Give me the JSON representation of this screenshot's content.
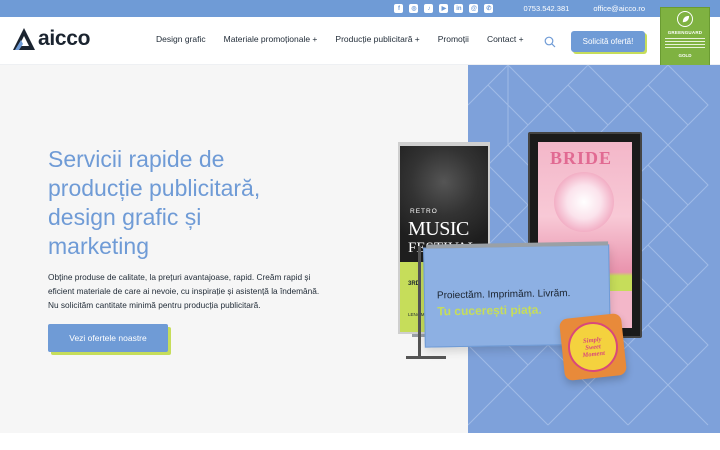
{
  "topbar": {
    "socials": [
      "facebook-icon",
      "instagram-icon",
      "tiktok-icon",
      "youtube-icon",
      "linkedin-icon",
      "threads-icon",
      "whatsapp-icon"
    ],
    "phone": "0753.542.381",
    "email": "office@aicco.ro"
  },
  "header": {
    "logo_text": "aicco",
    "nav": [
      {
        "label": "Design grafic"
      },
      {
        "label": "Materiale promoționale +"
      },
      {
        "label": "Producție publicitară +"
      },
      {
        "label": "Promoții"
      },
      {
        "label": "Contact +"
      }
    ],
    "cta_label": "Solicită ofertă!",
    "badge": {
      "name": "GREENGUARD",
      "level": "GOLD"
    }
  },
  "hero": {
    "headline": [
      "Servicii rapide de",
      "producție publicitară,",
      "design grafic și",
      "marketing"
    ],
    "lead": "Obține produse de calitate, la prețuri avantajoase, rapid. Creăm rapid și eficient materiale de care ai nevoie, cu inspirație și asistență la îndemână. Nu solicităm cantitate minimă pentru producția publicitară.",
    "cta_label": "Vezi ofertele noastre"
  },
  "collage": {
    "rollup": {
      "retro": "RETRO",
      "music": "MUSIC",
      "festival": "FESTIVAL",
      "number": "3RD",
      "fine": "LENA MONTEZ · THE VELVET"
    },
    "lightbox": {
      "title": "BRIDE"
    },
    "banner": {
      "line1": "Proiectăm. Imprimăm. Livrăm.",
      "line2": "Tu cucerești piața."
    },
    "sticker": {
      "line1": "Simply",
      "line2": "Sweet",
      "line3": "Moment"
    }
  },
  "colors": {
    "brand_blue": "#6f9bd6",
    "accent_lime": "#c6dd5a",
    "panel_blue": "#7ea1da"
  }
}
